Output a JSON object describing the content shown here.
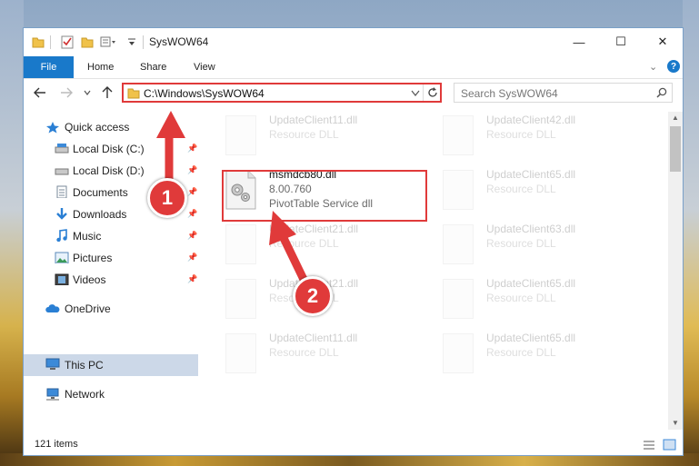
{
  "window": {
    "title": "SysWOW64",
    "minimize": "—",
    "maximize": "☐",
    "close": "✕"
  },
  "ribbon": {
    "tabs": [
      "File",
      "Home",
      "Share",
      "View"
    ],
    "help": "?"
  },
  "address": {
    "path": "C:\\Windows\\SysWOW64",
    "search_placeholder": "Search SysWOW64"
  },
  "sidebar": {
    "items": [
      {
        "label": "Quick access",
        "icon": "star-icon",
        "pinned": false
      },
      {
        "label": "Local Disk (C:)",
        "icon": "drive-icon",
        "pinned": true
      },
      {
        "label": "Local Disk (D:)",
        "icon": "drive-icon",
        "pinned": true
      },
      {
        "label": "Documents",
        "icon": "documents-icon",
        "pinned": true
      },
      {
        "label": "Downloads",
        "icon": "download-icon",
        "pinned": true
      },
      {
        "label": "Music",
        "icon": "music-icon",
        "pinned": true
      },
      {
        "label": "Pictures",
        "icon": "pictures-icon",
        "pinned": true
      },
      {
        "label": "Videos",
        "icon": "videos-icon",
        "pinned": true
      },
      {
        "label": "OneDrive",
        "icon": "cloud-icon",
        "pinned": false
      },
      {
        "label": "This PC",
        "icon": "computer-icon",
        "pinned": false,
        "selected": true
      },
      {
        "label": "Network",
        "icon": "network-icon",
        "pinned": false
      }
    ]
  },
  "files": [
    {
      "name": "UpdateClient11.dll",
      "desc": "Resource DLL",
      "faded": true
    },
    {
      "name": "UpdateClient42.dll",
      "desc": "Resource DLL",
      "faded": true
    },
    {
      "name": "msmdcb80.dll",
      "version": "8.00.760",
      "desc": "PivotTable Service dll",
      "faded": false
    },
    {
      "name": "UpdateClient65.dll",
      "desc": "Resource DLL",
      "faded": true
    },
    {
      "name": "UpdateClient21.dll",
      "desc": "Resource DLL",
      "faded": true
    },
    {
      "name": "UpdateClient63.dll",
      "desc": "Resource DLL",
      "faded": true
    },
    {
      "name": "UpdateClient21.dll",
      "desc": "Resource DLL",
      "faded": true
    },
    {
      "name": "UpdateClient65.dll",
      "desc": "Resource DLL",
      "faded": true
    },
    {
      "name": "UpdateClient11.dll",
      "desc": "Resource DLL",
      "faded": true
    },
    {
      "name": "UpdateClient65.dll",
      "desc": "Resource DLL",
      "faded": true
    }
  ],
  "status": {
    "item_count": "121 items"
  },
  "callouts": [
    "1",
    "2"
  ],
  "colors": {
    "accent": "#1979ca",
    "highlight": "#e03a3a"
  }
}
